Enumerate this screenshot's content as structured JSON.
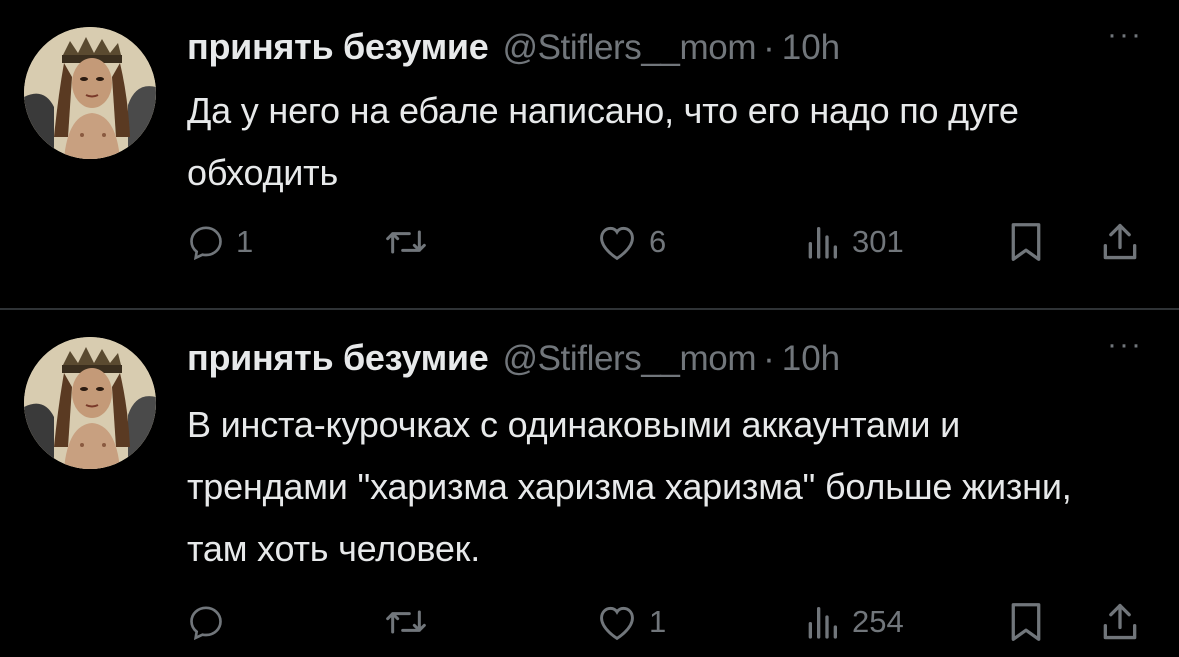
{
  "colors": {
    "background": "#000000",
    "text_primary": "#e7e9ea",
    "text_secondary": "#71767b",
    "divider": "#2f3336"
  },
  "tweets": [
    {
      "display_name": "принять безумие",
      "handle": "@Stiflers__mom",
      "separator": "·",
      "time": "10h",
      "more": "···",
      "text": "Да у него на ебале написано, что его надо по дуге обходить",
      "replies": "1",
      "reposts": "",
      "likes": "6",
      "views": "301",
      "icons": [
        "reply-icon",
        "repost-icon",
        "like-icon",
        "views-icon",
        "bookmark-icon",
        "share-icon"
      ]
    },
    {
      "display_name": "принять безумие",
      "handle": "@Stiflers__mom",
      "separator": "·",
      "time": "10h",
      "more": "···",
      "text": "В инста-курочках с одинаковыми аккаунтами и трендами \"харизма харизма харизма\" больше жизни, там хоть человек.",
      "replies": "",
      "reposts": "",
      "likes": "1",
      "views": "254",
      "icons": [
        "reply-icon",
        "repost-icon",
        "like-icon",
        "views-icon",
        "bookmark-icon",
        "share-icon"
      ]
    }
  ]
}
